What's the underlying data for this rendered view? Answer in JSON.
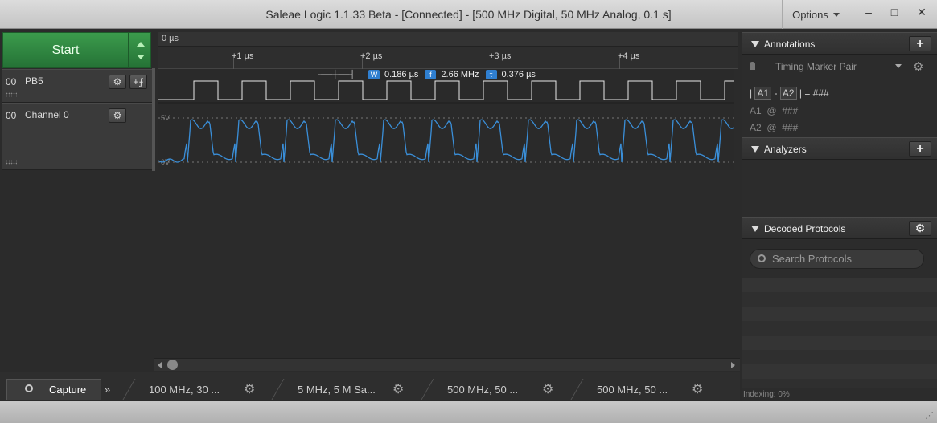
{
  "window": {
    "title": "Saleae Logic 1.1.33 Beta - [Connected] - [500 MHz Digital, 50 MHz Analog, 0.1 s]",
    "options_label": "Options",
    "min_glyph": "–",
    "max_glyph": "□",
    "close_glyph": "✕"
  },
  "capture": {
    "start_label": "Start"
  },
  "channels": [
    {
      "num": "00",
      "name": "PB5"
    },
    {
      "num": "00",
      "name": "Channel 0"
    }
  ],
  "timeline": {
    "origin": "0 µs",
    "ticks": [
      "+1 µs",
      "+2 µs",
      "+3 µs",
      "+4 µs"
    ]
  },
  "measurement": {
    "width_badge": "W",
    "width": "0.186 µs",
    "freq_badge": "f",
    "freq": "2.66 MHz",
    "period_badge": "τ",
    "period": "0.376 µs"
  },
  "analog": {
    "top_label": "5V",
    "bottom_label": "0V",
    "color": "#3a8fd9"
  },
  "tabs": {
    "capture": "Capture",
    "more": "»",
    "sessions": [
      "100 MHz, 30 ...",
      "5 MHz, 5 M Sa...",
      "500 MHz, 50 ...",
      "500 MHz, 50 ..."
    ]
  },
  "right_panel": {
    "annotations": {
      "title": "Annotations",
      "selector": "Timing Marker Pair",
      "line1": {
        "a1": "A1",
        "sep": "-",
        "a2": "A2",
        "value": "| = ###"
      },
      "line2": {
        "label": "A1",
        "at": "@",
        "value": "###"
      },
      "line3": {
        "label": "A2",
        "at": "@",
        "value": "###"
      }
    },
    "analyzers": {
      "title": "Analyzers"
    },
    "decoded": {
      "title": "Decoded Protocols",
      "search_placeholder": "Search Protocols"
    },
    "indexing": "Indexing: 0%"
  }
}
